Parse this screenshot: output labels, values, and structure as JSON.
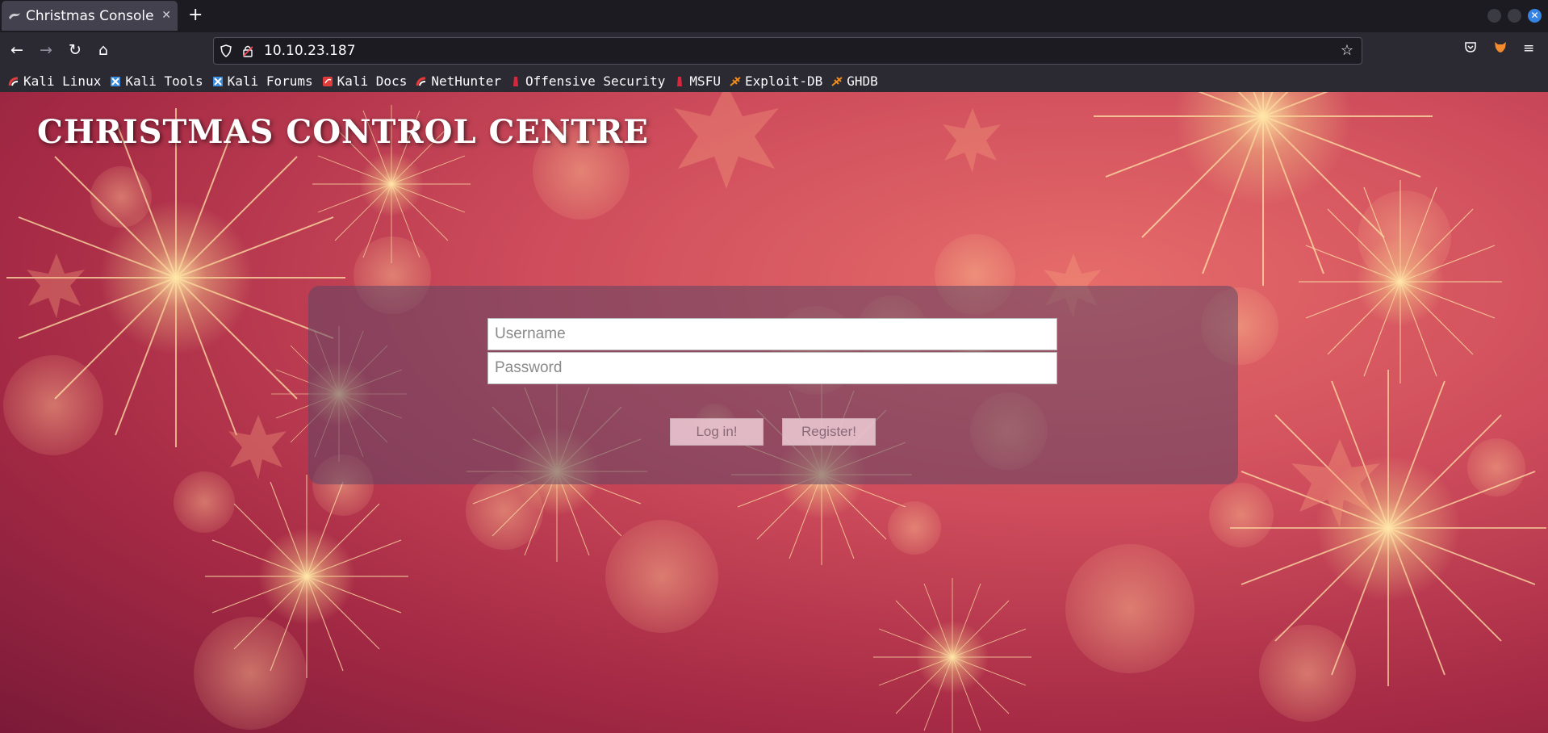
{
  "browser": {
    "tab": {
      "title": "Christmas Console",
      "favicon": "kali-dragon-icon"
    },
    "url": "10.10.23.187",
    "bookmarks": [
      {
        "label": "Kali Linux",
        "icon": "kali-icon",
        "color": "#e03c3c"
      },
      {
        "label": "Kali Tools",
        "icon": "kali-tools-icon",
        "color": "#3b8de0"
      },
      {
        "label": "Kali Forums",
        "icon": "kali-forums-icon",
        "color": "#3b8de0"
      },
      {
        "label": "Kali Docs",
        "icon": "kali-docs-icon",
        "color": "#e03c3c"
      },
      {
        "label": "NetHunter",
        "icon": "nethunter-icon",
        "color": "#e03c3c"
      },
      {
        "label": "Offensive Security",
        "icon": "offsec-icon",
        "color": "#d7263d"
      },
      {
        "label": "MSFU",
        "icon": "msfu-icon",
        "color": "#d7263d"
      },
      {
        "label": "Exploit-DB",
        "icon": "exploitdb-icon",
        "color": "#f08c1c"
      },
      {
        "label": "GHDB",
        "icon": "ghdb-icon",
        "color": "#f08c1c"
      }
    ]
  },
  "page": {
    "title": "CHRISTMAS CONTROL CENTRE",
    "login": {
      "username_placeholder": "Username",
      "password_placeholder": "Password",
      "login_label": "Log in!",
      "register_label": "Register!"
    }
  }
}
